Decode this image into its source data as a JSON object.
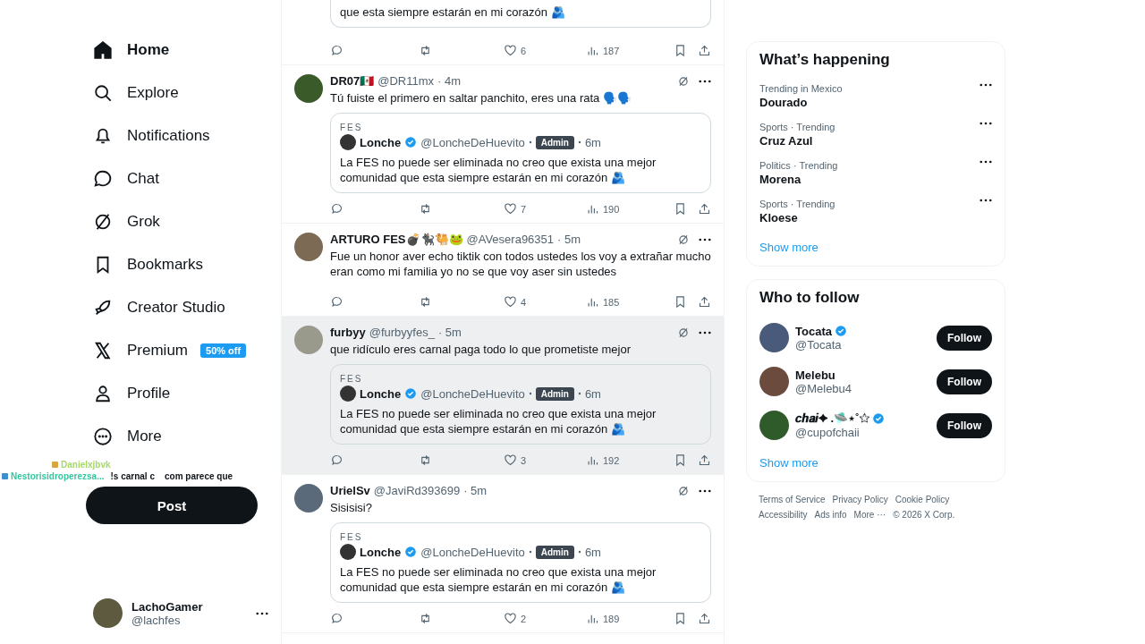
{
  "nav": {
    "items": [
      {
        "label": "Home",
        "selected": true
      },
      {
        "label": "Explore",
        "selected": false
      },
      {
        "label": "Notifications",
        "selected": false
      },
      {
        "label": "Chat",
        "selected": false
      },
      {
        "label": "Grok",
        "selected": false
      },
      {
        "label": "Bookmarks",
        "selected": false
      },
      {
        "label": "Creator Studio",
        "selected": false
      },
      {
        "label": "Premium",
        "selected": false,
        "badge": "50% off"
      },
      {
        "label": "Profile",
        "selected": false
      },
      {
        "label": "More",
        "selected": false
      }
    ],
    "post_button": "Post",
    "account": {
      "name": "LachoGamer",
      "handle": "@lachfes"
    }
  },
  "chat_overlay": [
    {
      "user": "Danielxjbvk"
    },
    {
      "user": "Nestorisidroperezsa...",
      "message": "!s carnal c",
      "message_2": "com parece que"
    }
  ],
  "feed": {
    "top_fragment": {
      "quote_line": "que esta siempre estarán en mi corazón 🫂",
      "likes": "6",
      "views": "187"
    },
    "posts": [
      {
        "name": "DR07🇲🇽",
        "handle": "@DR11mx",
        "time": "· 4m",
        "text": "Tú fuiste el primero en saltar panchito, eres una rata 🗣️🗣️",
        "hovered": false,
        "likes": "7",
        "views": "190",
        "quote": {
          "community": "FES",
          "name": "Lonche",
          "handle": "@LoncheDeHuevito",
          "badge": "Admin",
          "time": "6m",
          "text": "La FES no puede ser eliminada no creo que exista una mejor comunidad que esta siempre estarán en mi corazón 🫂"
        }
      },
      {
        "name": "ARTURO FES💣🐈‍⬛🐫🐸",
        "handle": "@AVesera96351",
        "time": "· 5m",
        "text": "Fue un honor aver echo tiktik con todos ustedes los voy a extrañar mucho eran como mi familia yo no se que voy aser sin ustedes",
        "hovered": false,
        "likes": "4",
        "views": "185"
      },
      {
        "name": "furbyy",
        "handle": "@furbyyfes_",
        "time": "· 5m",
        "text": "que ridículo eres carnal paga todo lo que prometiste mejor",
        "hovered": true,
        "likes": "3",
        "views": "192",
        "quote": {
          "community": "FES",
          "name": "Lonche",
          "handle": "@LoncheDeHuevito",
          "badge": "Admin",
          "time": "6m",
          "text": "La FES no puede ser eliminada no creo que exista una mejor comunidad que esta siempre estarán en mi corazón 🫂"
        }
      },
      {
        "name": "UrielSv",
        "handle": "@JaviRd393699",
        "time": "· 5m",
        "text": "Sisisisi?",
        "hovered": false,
        "likes": "2",
        "views": "189",
        "quote": {
          "community": "FES",
          "name": "Lonche",
          "handle": "@LoncheDeHuevito",
          "badge": "Admin",
          "time": "6m",
          "text": "La FES no puede ser eliminada no creo que exista una mejor comunidad que esta siempre estarán en mi corazón 🫂"
        }
      }
    ]
  },
  "trending": {
    "title": "What’s happening",
    "items": [
      {
        "context": "Trending in Mexico",
        "topic": "Dourado"
      },
      {
        "context": "Sports · Trending",
        "topic": "Cruz Azul"
      },
      {
        "context": "Politics · Trending",
        "topic": "Morena"
      },
      {
        "context": "Sports · Trending",
        "topic": "Kloese"
      }
    ],
    "show_more": "Show more"
  },
  "who_to_follow": {
    "title": "Who to follow",
    "accounts": [
      {
        "name": "Tocata",
        "handle": "@Tocata",
        "verified": true,
        "button": "Follow",
        "color": "#4a5a7a"
      },
      {
        "name": "Melebu",
        "handle": "@Melebu4",
        "verified": false,
        "button": "Follow",
        "color": "#6b4b3e"
      },
      {
        "name": "𝒄𝒉𝒂𝒊✦ .🛸⋆˚✩",
        "handle": "@cupofchaii",
        "verified": true,
        "button": "Follow",
        "color": "#2f5a2a"
      }
    ],
    "show_more": "Show more"
  },
  "footer": [
    "Terms of Service",
    "Privacy Policy",
    "Cookie Policy",
    "Accessibility",
    "Ads info",
    "More ···",
    "© 2026 X Corp."
  ]
}
